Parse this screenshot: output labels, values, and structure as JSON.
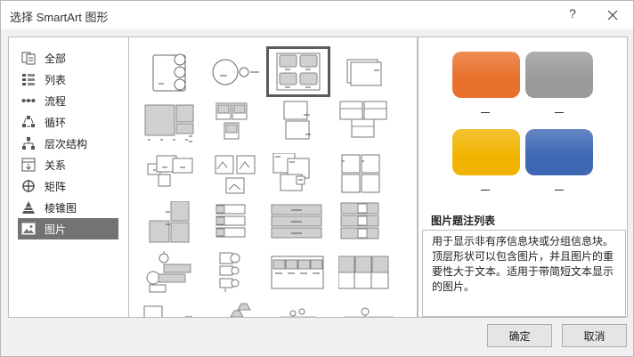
{
  "title": "选择 SmartArt 图形",
  "help_label": "?",
  "categories": [
    {
      "label": "全部",
      "icon": "all-icon"
    },
    {
      "label": "列表",
      "icon": "list-icon"
    },
    {
      "label": "流程",
      "icon": "process-icon"
    },
    {
      "label": "循环",
      "icon": "cycle-icon"
    },
    {
      "label": "层次结构",
      "icon": "hierarchy-icon"
    },
    {
      "label": "关系",
      "icon": "relationship-icon"
    },
    {
      "label": "矩阵",
      "icon": "matrix-icon"
    },
    {
      "label": "棱锥图",
      "icon": "pyramid-icon"
    },
    {
      "label": "图片",
      "icon": "picture-icon"
    }
  ],
  "selected_category": "图片",
  "preview": {
    "name": "图片题注列表",
    "description": "用于显示非有序信息块或分组信息块。顶层形状可以包含图片，并且图片的重要性大于文本。适用于带简短文本显示的图片。",
    "colors": [
      "#e8702a",
      "#9a9a9a",
      "#f0b400",
      "#3e68b3"
    ]
  },
  "buttons": {
    "ok": "确定",
    "cancel": "取消"
  }
}
